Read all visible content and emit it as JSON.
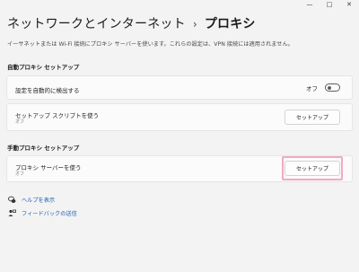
{
  "window": {
    "minimize_glyph": "—",
    "maximize_glyph": "□",
    "close_glyph": "✕"
  },
  "breadcrumb": {
    "parent": "ネットワークとインターネット",
    "separator": "›",
    "current": "プロキシ"
  },
  "description": "イーサネットまたは Wi-Fi 接続にプロキシ サーバーを使います。これらの設定は、VPN 接続には適用されません。",
  "auto_proxy": {
    "heading": "自動プロキシ セットアップ",
    "detect_label": "設定を自動的に検出する",
    "detect_state": "オフ",
    "detect_on": false,
    "script_label": "セットアップ スクリプトを使う",
    "script_state": "オフ",
    "script_button": "セットアップ"
  },
  "manual_proxy": {
    "heading": "手動プロキシ セットアップ",
    "server_label": "プロキシ サーバーを使う",
    "server_state": "オフ",
    "server_button": "セットアップ"
  },
  "links": {
    "help": "ヘルプを表示",
    "feedback": "フィードバックの送信"
  },
  "colors": {
    "highlight": "#f4a7c7",
    "link": "#1a5fb4"
  },
  "icons": {
    "help": "help-icon",
    "feedback": "feedback-icon"
  }
}
